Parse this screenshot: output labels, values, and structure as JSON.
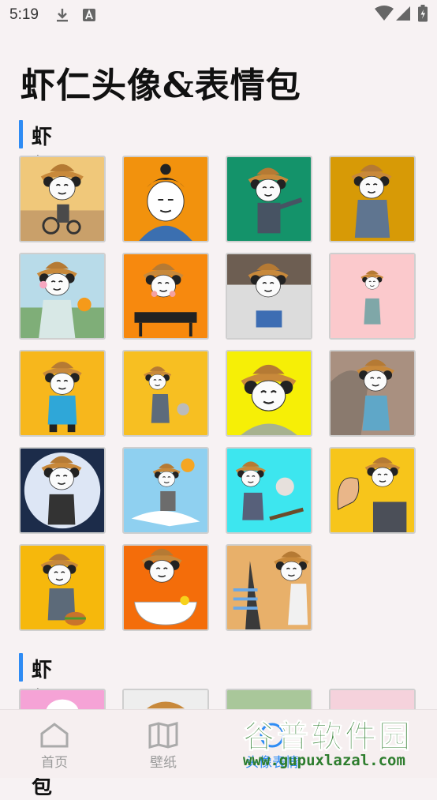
{
  "status_bar": {
    "time": "5:19"
  },
  "page_title": "虾仁头像&表情包",
  "sections": [
    {
      "label": "虾仁头像"
    },
    {
      "label": "虾仁表情包"
    }
  ],
  "avatar_grid": {
    "row1": [
      "tricycle-avatar",
      "samurai-avatar",
      "pointing-avatar",
      "standing-avatar"
    ],
    "row2": [
      "flower-avatar",
      "bbq-avatar",
      "bench-avatar",
      "pink-avatar"
    ],
    "row3": [
      "yellow-avatar",
      "robot-avatar",
      "closeup-avatar",
      "lion-avatar"
    ],
    "row4": [
      "moon-avatar",
      "crane-avatar",
      "cyan-avatar",
      "muscle-avatar"
    ],
    "row5": [
      "burger-avatar",
      "bath-avatar",
      "arrows-avatar"
    ]
  },
  "bottom_nav": {
    "home": "首页",
    "wallpaper": "壁纸",
    "emoji": "头像表情"
  },
  "watermark": {
    "brand": "谷普软件园",
    "url": "www.gupuxlazal.com"
  },
  "colors": {
    "accent": "#2f8cf4",
    "watermark": "#2e7d2e"
  }
}
